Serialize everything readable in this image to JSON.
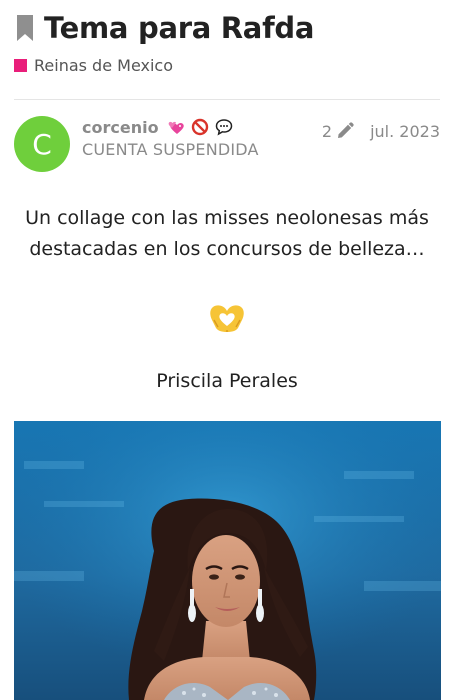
{
  "topic": {
    "title": "Tema para Rafda",
    "category": {
      "label": "Reinas de Mexico",
      "color": "#e91e7a"
    }
  },
  "post": {
    "author": {
      "avatar_letter": "C",
      "avatar_color": "#6fcf3c",
      "username": "corcenio",
      "user_title": "CUENTA SUSPENDIDA",
      "flair_icons": [
        "two-hearts-icon",
        "no-entry-icon",
        "speech-bubble-icon"
      ]
    },
    "edit_count": "2",
    "date": "jul. 2023",
    "body_text": "Un collage con las misses neolonesas más destacadas en los concursos de belleza…",
    "emoji": "heart-hands-icon",
    "caption": "Priscila Perales"
  },
  "colors": {
    "title": "#222222",
    "meta": "#8a8a8a",
    "divider": "#e5e5e5"
  }
}
